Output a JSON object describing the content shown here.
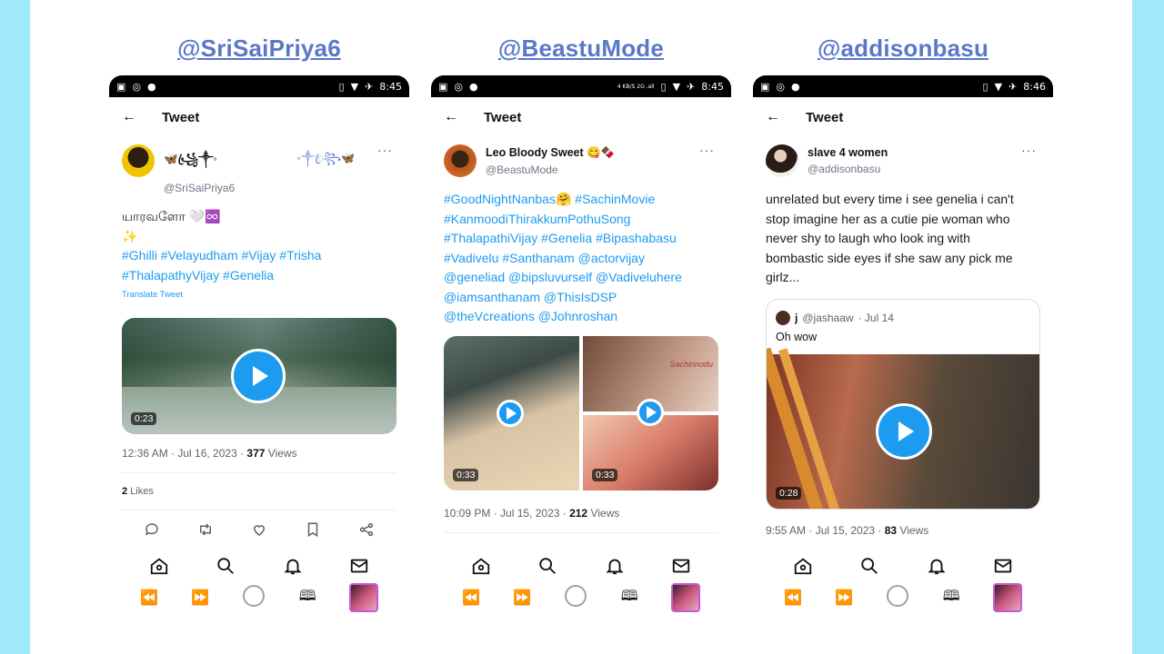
{
  "columns": [
    {
      "handle": "@SriSaiPriya6",
      "status": {
        "time": "8:45"
      },
      "topbar": {
        "back": "←",
        "title": "Tweet"
      },
      "author": {
        "display_name": "🦋꧁ꦿ༒◦",
        "extra": "◦༒ꦿ꧂🦋",
        "username": "@SriSaiPriya6"
      },
      "tweet": {
        "text_line1": "யாரவளோ 🤍♾️",
        "text_line2": "✨",
        "hashtags_line1": "#Ghilli #Velayudham #Vijay #Trisha",
        "hashtags_line2": "#ThalapathyVijay #Genelia",
        "translate": "Translate Tweet"
      },
      "media": {
        "duration": "0:23"
      },
      "meta": {
        "time": "12:36 AM · Jul 16, 2023 · ",
        "views": "377",
        "views_label": " Views"
      },
      "likes": {
        "count": "2",
        "label": " Likes"
      }
    },
    {
      "handle": "@BeastuMode",
      "status": {
        "time": "8:45",
        "net": "4 KB/S 2G .all"
      },
      "topbar": {
        "back": "←",
        "title": "Tweet"
      },
      "author": {
        "display_name": "Leo Bloody Sweet 😋🍫",
        "username": "@BeastuMode"
      },
      "tweet": {
        "lines": [
          "#GoodNightNanbas🤗 #SachinMovie",
          "#KanmoodiThirakkumPothuSong",
          "#ThalapathiVijay #Genelia #Bipashabasu",
          "#Vadivelu #Santhanam @actorvijay",
          "@geneliad @bipsluvurself @Vadiveluhere",
          "@iamsanthanam @ThisIsDSP",
          "@theVcreations @Johnroshan"
        ]
      },
      "media": {
        "duration_left": "0:33",
        "duration_right": "0:33",
        "overlay_text": "Sachinnodu"
      },
      "meta": {
        "time": "10:09 PM · Jul 15, 2023 · ",
        "views": "212",
        "views_label": " Views"
      }
    },
    {
      "handle": "@addisonbasu",
      "status": {
        "time": "8:46"
      },
      "topbar": {
        "back": "←",
        "title": "Tweet"
      },
      "author": {
        "display_name": "slave 4 women",
        "username": "@addisonbasu"
      },
      "tweet": {
        "lines": [
          "unrelated but every time i see genelia i can't",
          "stop imagine her as a cutie pie woman who",
          "never shy to laugh who look ing with",
          "bombastic side eyes if she saw any pick me",
          "girlz..."
        ]
      },
      "quote": {
        "name": "j",
        "username": "@jashaaw",
        "date": "· Jul 14",
        "text": "Oh wow"
      },
      "media": {
        "duration": "0:28"
      },
      "meta": {
        "time": "9:55 AM · Jul 15, 2023 · ",
        "views": "83",
        "views_label": " Views"
      }
    }
  ],
  "colors": {
    "accent": "#1d9bf0",
    "handle": "#5a78c8",
    "frame": "#9fe9fb"
  },
  "icons": {
    "nav": [
      "home-icon",
      "search-icon",
      "bell-icon",
      "mail-icon"
    ],
    "sysnav": [
      "rewind-icon",
      "forward-icon",
      "circle-icon",
      "book-icon",
      "avatar"
    ],
    "actions": [
      "reply-icon",
      "retweet-icon",
      "like-icon",
      "bookmark-icon",
      "share-icon"
    ]
  }
}
